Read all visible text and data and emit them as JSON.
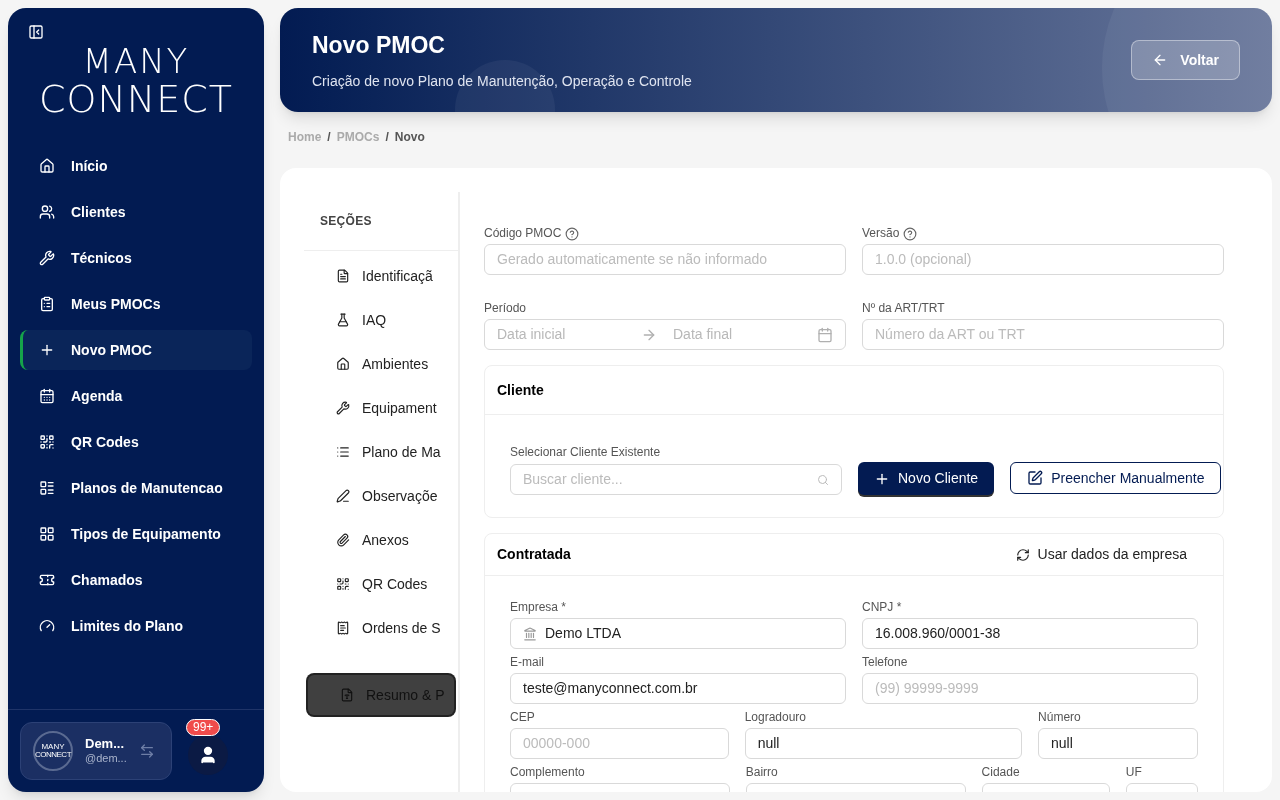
{
  "sidebar": {
    "logo": {
      "line_1": "MANY",
      "line_2": "CONNECT"
    },
    "items": [
      {
        "label": "Início",
        "selected": false
      },
      {
        "label": "Clientes",
        "selected": false
      },
      {
        "label": "Técnicos",
        "selected": false
      },
      {
        "label": "Meus PMOCs",
        "selected": false
      },
      {
        "label": "Novo PMOC",
        "selected": true
      },
      {
        "label": "Agenda",
        "selected": false
      },
      {
        "label": "QR Codes",
        "selected": false
      },
      {
        "label": "Planos de Manutencao",
        "selected": false
      },
      {
        "label": "Tipos de Equipamento",
        "selected": false
      },
      {
        "label": "Chamados",
        "selected": false
      },
      {
        "label": "Limites do Plano",
        "selected": false
      }
    ],
    "user": {
      "avatar_line_1": "MANY",
      "avatar_line_2": "CONNECT",
      "name": "Dem...",
      "handle": "@dem..."
    },
    "notifications": {
      "badge": "99+"
    }
  },
  "header": {
    "title": "Novo PMOC",
    "subtitle": "Criação de novo Plano de Manutenção, Operação e Controle",
    "back_button": "Voltar"
  },
  "breadcrumb": {
    "separator": "/",
    "items": [
      {
        "label": "Home",
        "current": false
      },
      {
        "label": "PMOCs",
        "current": false
      },
      {
        "label": "Novo",
        "current": true
      }
    ]
  },
  "sections": {
    "title": "SEÇÕES",
    "items": [
      {
        "label": "Identificaçã",
        "selected": false
      },
      {
        "label": "IAQ",
        "selected": false
      },
      {
        "label": "Ambientes",
        "selected": false
      },
      {
        "label": "Equipament",
        "selected": false
      },
      {
        "label": "Plano de Ma",
        "selected": false
      },
      {
        "label": "Observaçõe",
        "selected": false
      },
      {
        "label": "Anexos",
        "selected": false
      },
      {
        "label": "QR Codes",
        "selected": false
      },
      {
        "label": "Ordens de S",
        "selected": false
      },
      {
        "label": "Resumo & P",
        "selected": true
      }
    ]
  },
  "top_fields": [
    {
      "kind": "help_text",
      "label": "Código PMOC",
      "placeholder": "Gerado automaticamente se não informado"
    },
    {
      "kind": "help_text",
      "label": "Versão",
      "placeholder": "1.0.0 (opcional)"
    },
    {
      "kind": "date_range",
      "label": "Período",
      "placeholder": "Data inicial",
      "placeholder_2": "Data final"
    },
    {
      "kind": "text",
      "label": "Nº da ART/TRT",
      "placeholder": "Número da ART ou TRT"
    }
  ],
  "cliente": {
    "title": "Cliente",
    "search_label": "Selecionar Cliente Existente",
    "search_placeholder": "Buscar cliente...",
    "new_button": "Novo Cliente",
    "manual_button": "Preencher Manualmente"
  },
  "contratada": {
    "title": "Contratada",
    "action": "Usar dados da empresa",
    "rows": [
      [
        {
          "kind": "company",
          "label": "Empresa *",
          "value": "Demo LTDA"
        },
        {
          "kind": "text",
          "label": "CNPJ *",
          "value": "16.008.960/0001-38"
        }
      ],
      [
        {
          "kind": "text",
          "label": "E-mail",
          "value": "teste@manyconnect.com.br"
        },
        {
          "kind": "text",
          "label": "Telefone",
          "placeholder": "(99) 99999-9999"
        }
      ],
      [
        {
          "kind": "text",
          "label": "CEP",
          "placeholder": "00000-000"
        },
        {
          "kind": "text",
          "label": "Logradouro",
          "value": "null"
        },
        {
          "kind": "text",
          "label": "Número",
          "value": "null"
        }
      ],
      [
        {
          "kind": "text",
          "label": "Complemento"
        },
        {
          "kind": "text",
          "label": "Bairro"
        },
        {
          "kind": "text",
          "label": "Cidade"
        },
        {
          "kind": "text",
          "label": "UF"
        }
      ]
    ]
  }
}
